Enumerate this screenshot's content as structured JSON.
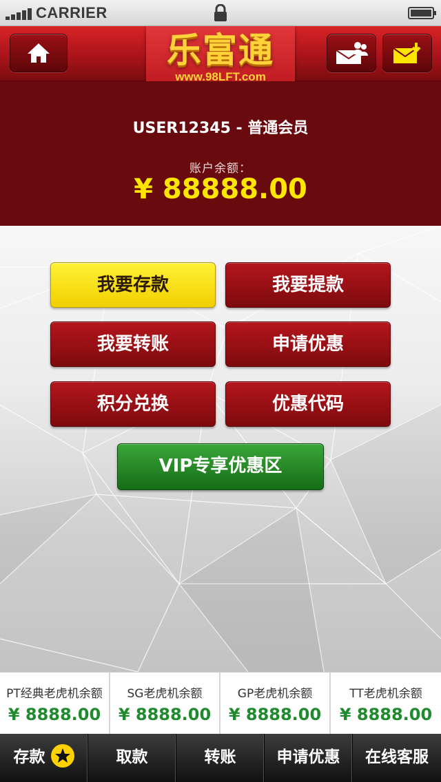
{
  "status_bar": {
    "carrier": "CARRIER"
  },
  "header": {
    "logo_title": "乐富通",
    "logo_url": "www.98LFT.com",
    "icons": [
      "home-icon",
      "message-contacts-icon",
      "mail-download-icon"
    ]
  },
  "account": {
    "user": "USER12345 - 普通会员",
    "balance_label": "账户余额：",
    "balance": "¥ 88888.00"
  },
  "actions": [
    {
      "label": "我要存款",
      "style": "yellow"
    },
    {
      "label": "我要提款",
      "style": "red"
    },
    {
      "label": "我要转账",
      "style": "red"
    },
    {
      "label": "申请优惠",
      "style": "red"
    },
    {
      "label": "积分兑换",
      "style": "red"
    },
    {
      "label": "优惠代码",
      "style": "red"
    }
  ],
  "vip_button": "VIP专享优惠区",
  "balances": [
    {
      "label": "PT经典老虎机余额",
      "value": "¥ 8888.00"
    },
    {
      "label": "SG老虎机余额",
      "value": "¥ 8888.00"
    },
    {
      "label": "GP老虎机余额",
      "value": "¥ 8888.00"
    },
    {
      "label": "TT老虎机余额",
      "value": "¥ 8888.00"
    }
  ],
  "tabs": [
    "存款",
    "取款",
    "转账",
    "申请优惠",
    "在线客服"
  ],
  "colors": {
    "header_red": "#b8151b",
    "account_bg": "#680a0e",
    "balance_yellow": "#ffe600",
    "button_red": "#8f1015",
    "button_yellow": "#f7dc10",
    "button_green": "#1f7e1f",
    "balance_green": "#1f8a2e",
    "tabbar_bg": "#1c1c1c"
  }
}
